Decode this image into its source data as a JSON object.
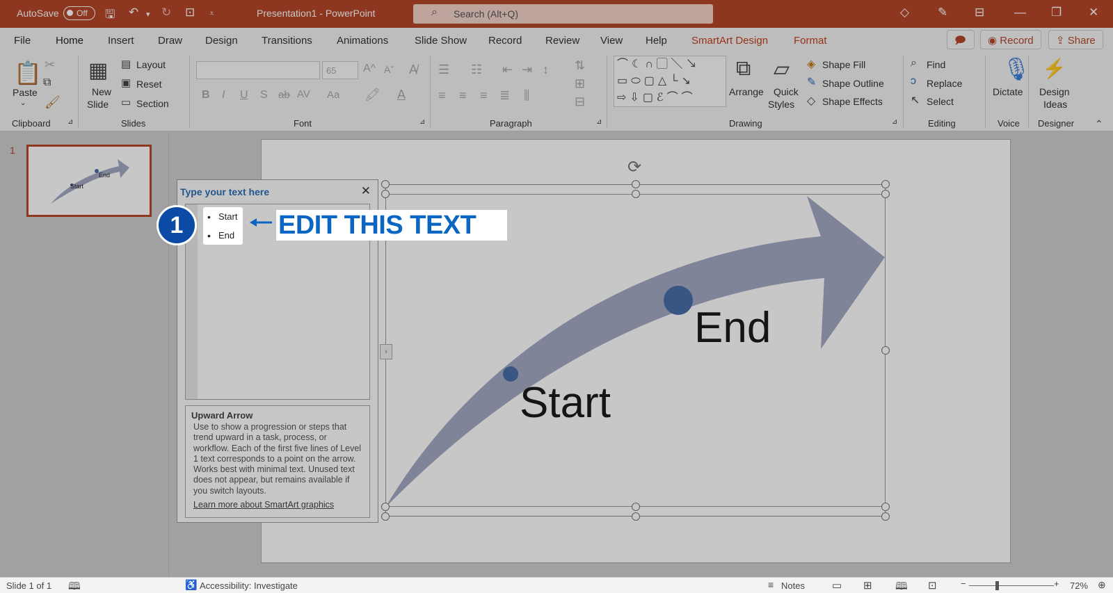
{
  "titlebar": {
    "autosave_label": "AutoSave",
    "autosave_state": "Off",
    "doc_title": "Presentation1  -  PowerPoint",
    "search_placeholder": "Search (Alt+Q)"
  },
  "tabs": [
    "File",
    "Home",
    "Insert",
    "Draw",
    "Design",
    "Transitions",
    "Animations",
    "Slide Show",
    "Record",
    "Review",
    "View",
    "Help",
    "SmartArt Design",
    "Format"
  ],
  "top_buttons": {
    "record": "Record",
    "share": "Share"
  },
  "ribbon": {
    "clipboard": {
      "paste": "Paste",
      "group": "Clipboard"
    },
    "slides": {
      "new_slide_1": "New",
      "new_slide_2": "Slide",
      "layout": "Layout",
      "reset": "Reset",
      "section": "Section",
      "group": "Slides"
    },
    "font": {
      "size": "65",
      "group": "Font"
    },
    "paragraph": {
      "group": "Paragraph"
    },
    "drawing": {
      "arrange": "Arrange",
      "quick_styles_1": "Quick",
      "quick_styles_2": "Styles",
      "shape_fill": "Shape Fill",
      "shape_outline": "Shape Outline",
      "shape_effects": "Shape Effects",
      "group": "Drawing"
    },
    "editing": {
      "find": "Find",
      "replace": "Replace",
      "select": "Select",
      "group": "Editing"
    },
    "voice": {
      "dictate": "Dictate",
      "group": "Voice"
    },
    "designer": {
      "design_ideas_1": "Design",
      "design_ideas_2": "Ideas",
      "group": "Designer"
    }
  },
  "slide_panel": {
    "slide_number": "1",
    "thumb_start": "Start",
    "thumb_end": "End"
  },
  "text_pane": {
    "header": "Type your text here",
    "close": "✕",
    "items": [
      "Start",
      "End"
    ],
    "desc_title": "Upward Arrow",
    "desc_text": "Use to show a progression or steps that trend upward in a task, process, or workflow. Each of the first five lines of Level 1 text corresponds to a point on the arrow. Works best with minimal text. Unused text does not appear, but remains available if you switch layouts.",
    "desc_link": "Learn more about SmartArt graphics"
  },
  "callout": {
    "number": "1",
    "text": "EDIT THIS TEXT"
  },
  "smartart": {
    "start_label": "Start",
    "end_label": "End"
  },
  "statusbar": {
    "slide_info": "Slide 1 of 1",
    "accessibility": "Accessibility: Investigate",
    "notes": "Notes",
    "zoom": "72%"
  },
  "colors": {
    "accent": "#b7472a",
    "callout_blue": "#0b4aa5",
    "arrow": "#a4aac3",
    "dot": "#4a6ea9"
  }
}
